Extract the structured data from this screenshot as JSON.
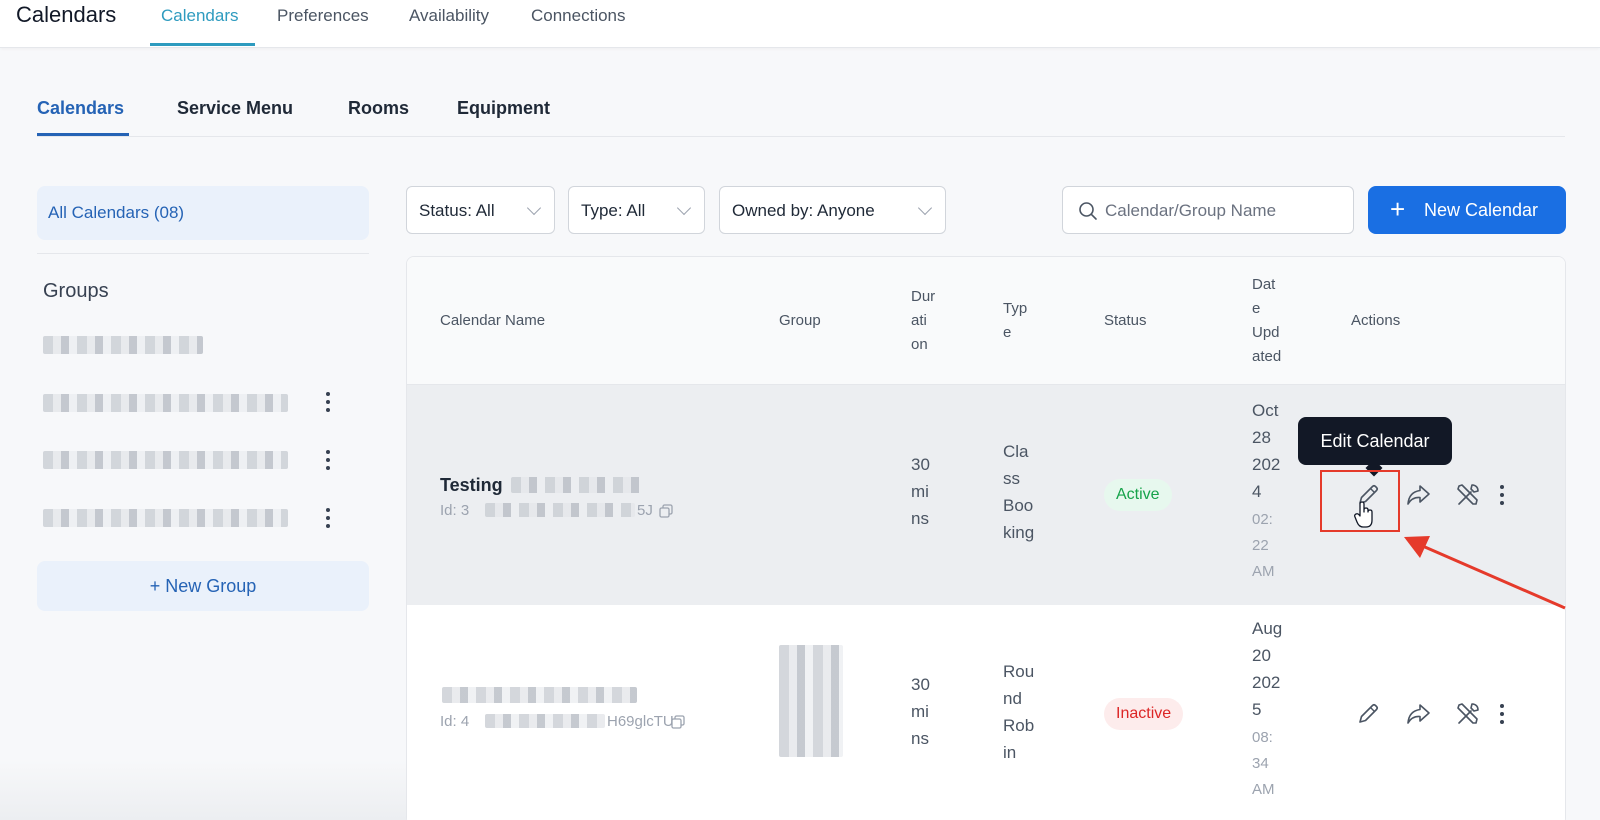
{
  "header": {
    "app_title": "Calendars",
    "tabs": [
      {
        "label": "Calendars",
        "active": true
      },
      {
        "label": "Preferences",
        "active": false
      },
      {
        "label": "Availability",
        "active": false
      },
      {
        "label": "Connections",
        "active": false
      }
    ]
  },
  "subtabs": [
    {
      "label": "Calendars",
      "active": true
    },
    {
      "label": "Service Menu",
      "active": false
    },
    {
      "label": "Rooms",
      "active": false
    },
    {
      "label": "Equipment",
      "active": false
    }
  ],
  "sidebar": {
    "all_calendars": "All Calendars (08)",
    "groups_title": "Groups",
    "new_group_label": "+ New Group"
  },
  "filters": {
    "status": "Status: All",
    "type": "Type: All",
    "owned_by": "Owned by: Anyone"
  },
  "search": {
    "placeholder": "Calendar/Group Name"
  },
  "new_calendar": {
    "plus": "+",
    "label": "New Calendar"
  },
  "table": {
    "headers": {
      "calendar_name": "Calendar Name",
      "group": "Group",
      "duration": [
        "Dur",
        "ati",
        "on"
      ],
      "type": [
        "Typ",
        "e"
      ],
      "status": "Status",
      "date_updated": [
        "Dat",
        "e",
        "Upd",
        "ated"
      ],
      "actions": "Actions"
    },
    "rows": [
      {
        "name": "Testing",
        "id_prefix": "Id: 3",
        "id_suffix": "5J",
        "duration": [
          "30",
          "mi",
          "ns"
        ],
        "type": [
          "Cla",
          "ss",
          "Boo",
          "king"
        ],
        "status": "Active",
        "date": [
          "Oct",
          "28",
          "202",
          "4"
        ],
        "time": [
          "02:",
          "22",
          "AM"
        ]
      },
      {
        "name": "",
        "id_prefix": "Id: 4",
        "id_suffix": "H69glcTU",
        "duration": [
          "30",
          "mi",
          "ns"
        ],
        "type": [
          "Rou",
          "nd",
          "Rob",
          "in"
        ],
        "status": "Inactive",
        "date": [
          "Aug",
          "20",
          "202",
          "5"
        ],
        "time": [
          "08:",
          "34",
          "AM"
        ]
      }
    ]
  },
  "tooltip": {
    "label": "Edit Calendar"
  },
  "colors": {
    "accent_blue": "#1a6fe3",
    "tab_teal": "#2e9bbf",
    "active_green": "#16a34a",
    "inactive_red": "#dc2626",
    "annotation_red": "#e53a2b"
  },
  "icons": [
    "search-icon",
    "chevron-down-icon",
    "pencil-icon",
    "share-icon",
    "tools-icon",
    "kebab-icon",
    "copy-icon",
    "hand-cursor-icon",
    "arrow-annotation-icon"
  ]
}
